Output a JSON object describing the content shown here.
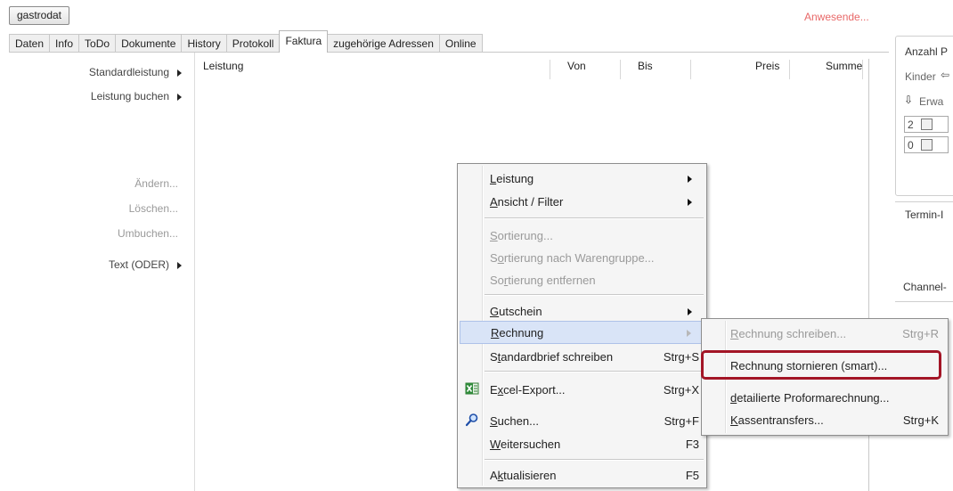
{
  "header": {
    "app_button": "gastrodat",
    "status_link": "Anwesende..."
  },
  "tabs": [
    "Daten",
    "Info",
    "ToDo",
    "Dokumente",
    "History",
    "Protokoll",
    "Faktura",
    "zugehörige Adressen",
    "Online"
  ],
  "active_tab": "Faktura",
  "left_panel": {
    "items": [
      {
        "label": "Standardleistung",
        "submenu": true,
        "enabled": true
      },
      {
        "label": "Leistung buchen",
        "submenu": true,
        "enabled": true
      },
      {
        "label": "Ändern...",
        "submenu": false,
        "enabled": false
      },
      {
        "label": "Löschen...",
        "submenu": false,
        "enabled": false
      },
      {
        "label": "Umbuchen...",
        "submenu": false,
        "enabled": false
      },
      {
        "label": "Text (ODER)",
        "submenu": true,
        "enabled": true
      }
    ]
  },
  "table": {
    "columns": [
      "Leistung",
      "Von",
      "Bis",
      "Preis",
      "Summe"
    ]
  },
  "right_panel": {
    "group1_title": "Anzahl P",
    "kinder_label": "Kinder",
    "erwachsene_label": "Erwa",
    "spin_values": [
      "2",
      "0"
    ],
    "group2_title": "Termin-I",
    "channel_label": "Channel-"
  },
  "context_menu": {
    "items": [
      {
        "label": "Leistung",
        "mnemonic": "L",
        "rest": "eistung",
        "shortcut": "",
        "submenu": true,
        "enabled": true
      },
      {
        "label": "Ansicht / Filter",
        "mnemonic": "A",
        "rest": "nsicht / Filter",
        "shortcut": "",
        "submenu": true,
        "enabled": true
      },
      {
        "label": "Sortierung...",
        "mnemonic": "S",
        "rest": "ortierung...",
        "shortcut": "",
        "submenu": false,
        "enabled": false
      },
      {
        "label": "Sortierung nach Warengruppe...",
        "shortcut": "",
        "submenu": false,
        "enabled": false
      },
      {
        "label": "Sortierung entfernen",
        "shortcut": "",
        "submenu": false,
        "enabled": false
      },
      {
        "label": "Gutschein",
        "mnemonic": "G",
        "rest": "utschein",
        "shortcut": "",
        "submenu": true,
        "enabled": true
      },
      {
        "label": "Rechnung",
        "mnemonic": "R",
        "rest": "echnung",
        "shortcut": "",
        "submenu": true,
        "enabled": true,
        "hover": true
      },
      {
        "label": "Standardbrief schreiben",
        "shortcut": "Strg+S",
        "submenu": false,
        "enabled": true
      },
      {
        "label": "Excel-Export...",
        "shortcut": "Strg+X",
        "submenu": false,
        "enabled": true,
        "icon": "excel-icon"
      },
      {
        "label": "Suchen...",
        "shortcut": "Strg+F",
        "submenu": false,
        "enabled": true,
        "icon": "search-icon"
      },
      {
        "label": "Weitersuchen",
        "shortcut": "F3",
        "submenu": false,
        "enabled": true
      },
      {
        "label": "Aktualisieren",
        "shortcut": "F5",
        "submenu": false,
        "enabled": true
      }
    ]
  },
  "submenu": {
    "items": [
      {
        "label": "Rechnung schreiben...",
        "shortcut": "Strg+R",
        "enabled": false
      },
      {
        "label": "Rechnung stornieren (smart)...",
        "shortcut": "",
        "enabled": true,
        "highlighted": true
      },
      {
        "label": "detailierte Proformarechnung...",
        "shortcut": "",
        "enabled": true
      },
      {
        "label": "Kassentransfers...",
        "shortcut": "Strg+K",
        "enabled": true
      }
    ]
  },
  "colors": {
    "highlight_border": "#a31526",
    "hover_bg": "#d9e4f7",
    "status_red": "#e86868"
  }
}
